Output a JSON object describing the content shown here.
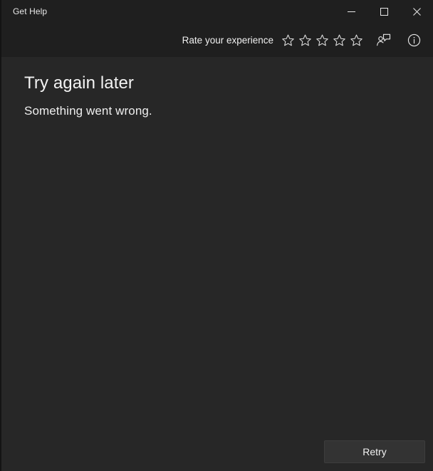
{
  "window": {
    "title": "Get Help",
    "controls": {
      "minimize": "Minimize",
      "maximize": "Maximize",
      "close": "Close"
    }
  },
  "commandbar": {
    "rate_label": "Rate your experience",
    "stars": [
      {
        "position": "1",
        "filled": false
      },
      {
        "position": "2",
        "filled": false
      },
      {
        "position": "3",
        "filled": false
      },
      {
        "position": "4",
        "filled": false
      },
      {
        "position": "5",
        "filled": false
      }
    ],
    "contact_support_icon": "person-chat-icon",
    "info_icon": "info-circle-icon"
  },
  "content": {
    "headline": "Try again later",
    "subtext": "Something went wrong."
  },
  "footer": {
    "retry_label": "Retry"
  },
  "colors": {
    "titlebar_bg": "#1f1f1f",
    "content_bg": "#272727",
    "button_bg": "#333333",
    "button_border": "#3d3d3d",
    "text_primary": "#f3f3f3"
  }
}
